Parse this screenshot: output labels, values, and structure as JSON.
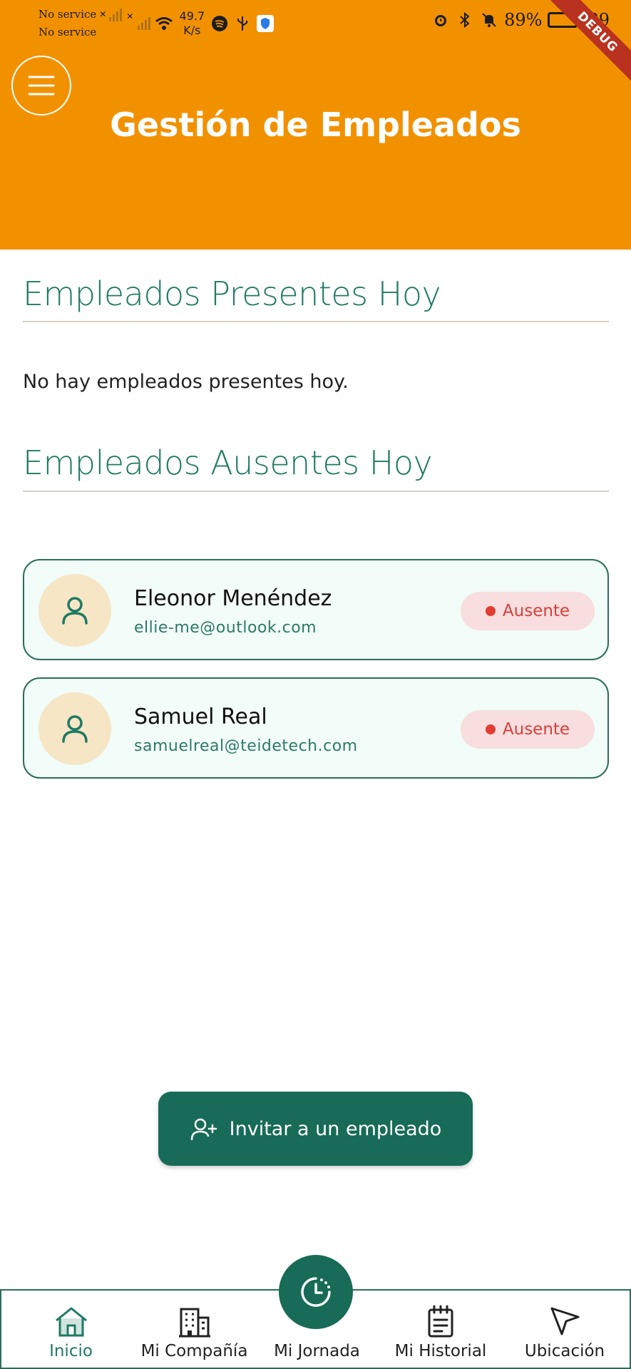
{
  "status_bar": {
    "carrier_1": "No service",
    "carrier_2": "No service",
    "speed_value": "49.7",
    "speed_unit": "K/s",
    "battery": "89%",
    "battery_2": "89",
    "debug_label": "DEBUG"
  },
  "header": {
    "title": "Gestión de Empleados",
    "background_color": "#F29100"
  },
  "present_section": {
    "title": "Empleados Presentes Hoy",
    "empty_message": "No hay empleados presentes hoy."
  },
  "absent_section": {
    "title": "Empleados Ausentes Hoy",
    "employees": [
      {
        "name": "Eleonor Menéndez",
        "email": "ellie-me@outlook.com",
        "status": "Ausente"
      },
      {
        "name": "Samuel Real",
        "email": "samuelreal@teidetech.com",
        "status": "Ausente"
      }
    ]
  },
  "invite_button": {
    "label": "Invitar a un empleado"
  },
  "bottom_nav": {
    "items": [
      {
        "label": "Inicio",
        "icon": "home-icon",
        "active": true
      },
      {
        "label": "Mi Compañía",
        "icon": "building-icon",
        "active": false
      },
      {
        "label": "Mi Jornada",
        "icon": "clock-icon",
        "active": false
      },
      {
        "label": "Mi Historial",
        "icon": "notepad-icon",
        "active": false
      },
      {
        "label": "Ubicación",
        "icon": "navigation-arrow-icon",
        "active": false
      }
    ]
  },
  "colors": {
    "primary": "#176B57",
    "accent": "#F29100",
    "absent_badge": "#E23C33"
  }
}
